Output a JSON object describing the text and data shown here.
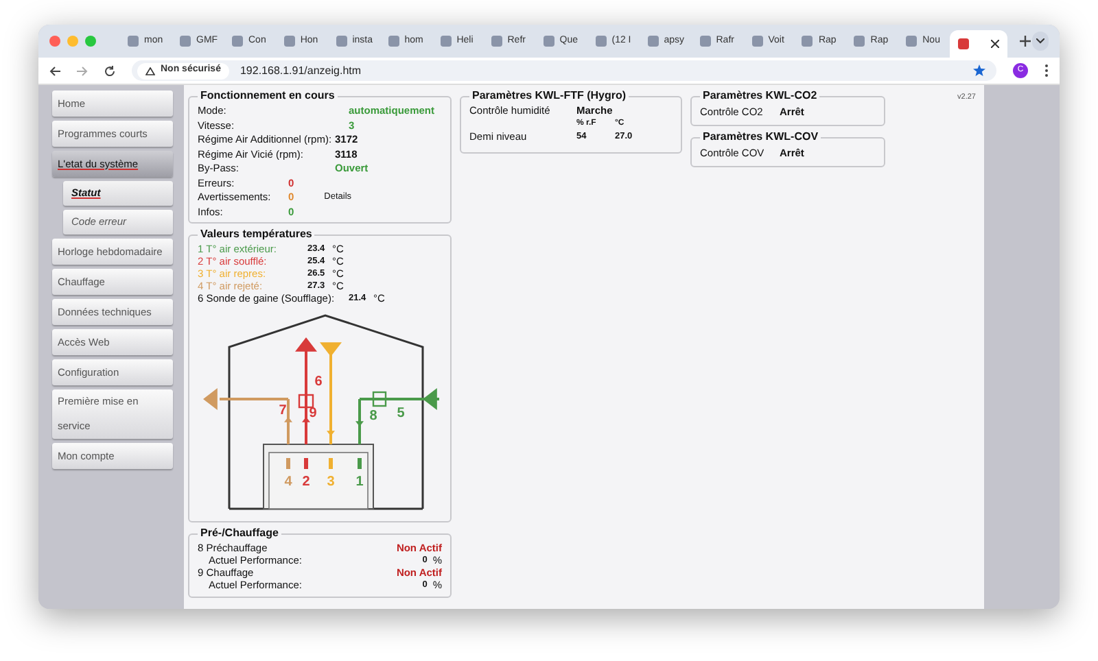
{
  "browser": {
    "tabs": [
      {
        "label": "mon",
        "selected": false
      },
      {
        "label": "GMF",
        "selected": false
      },
      {
        "label": "Con",
        "selected": false
      },
      {
        "label": "Hon",
        "selected": false
      },
      {
        "label": "insta",
        "selected": false
      },
      {
        "label": "hom",
        "selected": false
      },
      {
        "label": "Heli",
        "selected": false
      },
      {
        "label": "Refr",
        "selected": false
      },
      {
        "label": "Que",
        "selected": false
      },
      {
        "label": "(12 I",
        "selected": false
      },
      {
        "label": "apsy",
        "selected": false
      },
      {
        "label": "Rafr",
        "selected": false
      },
      {
        "label": "Voit",
        "selected": false
      },
      {
        "label": "Rap",
        "selected": false
      },
      {
        "label": "Rap",
        "selected": false
      },
      {
        "label": "Nou",
        "selected": false
      },
      {
        "selected": true
      }
    ],
    "address": {
      "security": "Non sécurisé",
      "url": "192.168.1.91/anzeig.htm"
    },
    "profile": "C"
  },
  "sidebar": {
    "items": [
      {
        "label": "Home",
        "kind": "main",
        "selected": false
      },
      {
        "label": "Programmes courts",
        "kind": "main",
        "selected": false
      },
      {
        "label": "L'etat du système",
        "kind": "main",
        "selected": true
      },
      {
        "label": "Statut",
        "kind": "sub",
        "selected": true
      },
      {
        "label": "Code erreur",
        "kind": "sub",
        "selected": false
      },
      {
        "label": "Horloge hebdomadaire",
        "kind": "main",
        "selected": false
      },
      {
        "label": "Chauffage",
        "kind": "main",
        "selected": false
      },
      {
        "label": "Données techniques",
        "kind": "main",
        "selected": false
      },
      {
        "label": "Accès Web",
        "kind": "main",
        "selected": false
      },
      {
        "label": "Configuration",
        "kind": "main",
        "selected": false
      },
      {
        "label": "Première mise en service",
        "kind": "main",
        "selected": false
      },
      {
        "label": "Mon compte",
        "kind": "main",
        "selected": false
      }
    ]
  },
  "status": {
    "title": "Fonctionnement en cours",
    "rows": [
      {
        "label": "Mode:",
        "value": "automatiquement",
        "color": "#3a9a3a"
      },
      {
        "label": "Vitesse:",
        "value": "3",
        "color": "#3a9a3a"
      },
      {
        "label": "Régime Air Additionnel (rpm):",
        "value": "3172",
        "color": "#111111"
      },
      {
        "label": "Régime Air Vicié (rpm):",
        "value": "3118",
        "color": "#111111"
      },
      {
        "label": "By-Pass:",
        "value": "Ouvert",
        "color": "#3a9a3a"
      },
      {
        "label": "Erreurs:",
        "value": "0",
        "color": "#d03030"
      },
      {
        "label": "Avertissements:",
        "value": "0",
        "color": "#e08a30",
        "link": "Details"
      },
      {
        "label": "Infos:",
        "value": "0",
        "color": "#3a9a3a"
      }
    ]
  },
  "temperatures": {
    "title": "Valeurs températures",
    "rows": [
      {
        "label": "1 T° air extérieur:",
        "value": "23.4",
        "unit": "°C",
        "color": "#4a9a4a"
      },
      {
        "label": "2 T° air soufflé:",
        "value": "25.4",
        "unit": "°C",
        "color": "#d83a3a"
      },
      {
        "label": "3 T° air repres:",
        "value": "26.5",
        "unit": "°C",
        "color": "#f0b030"
      },
      {
        "label": "4 T° air rejeté:",
        "value": "27.3",
        "unit": "°C",
        "color": "#d09a60"
      },
      {
        "label": "6 Sonde de gaine (Soufflage):",
        "value": "21.4",
        "unit": "°C",
        "color": "#111111"
      }
    ],
    "diagram_labels": [
      {
        "text": "6",
        "color": "#d83a3a"
      },
      {
        "text": "7",
        "color": "#d83a3a"
      },
      {
        "text": "9",
        "color": "#d83a3a"
      },
      {
        "text": "8",
        "color": "#4a9a4a"
      },
      {
        "text": "5",
        "color": "#4a9a4a"
      },
      {
        "text": "4",
        "color": "#d09a60"
      },
      {
        "text": "2",
        "color": "#d83a3a"
      },
      {
        "text": "3",
        "color": "#f0b030"
      },
      {
        "text": "1",
        "color": "#4a9a4a"
      }
    ]
  },
  "heating": {
    "title": "Pré-/Chauffage",
    "rows": [
      {
        "kind": "status",
        "label": "8 Préchauffage",
        "value": "Non Actif"
      },
      {
        "kind": "performance",
        "label": "Actuel Performance:",
        "value": "0",
        "unit": "%"
      },
      {
        "kind": "status",
        "label": "9 Chauffage",
        "value": "Non Actif"
      },
      {
        "kind": "performance",
        "label": "Actuel Performance:",
        "value": "0",
        "unit": "%"
      }
    ]
  },
  "hygro": {
    "title": "Paramètres KWL-FTF (Hygro)",
    "control_label": "Contrôle humidité",
    "control_value": "Marche",
    "headers": [
      "% r.F",
      "°C"
    ],
    "row_label": "Demi niveau",
    "values": [
      "54",
      "27.0"
    ]
  },
  "co2": {
    "title": "Paramètres KWL-CO2",
    "label": "Contrôle CO2",
    "value": "Arrêt"
  },
  "cov": {
    "title": "Paramètres KWL-COV",
    "label": "Contrôle COV",
    "value": "Arrêt"
  },
  "version": "v2.27"
}
